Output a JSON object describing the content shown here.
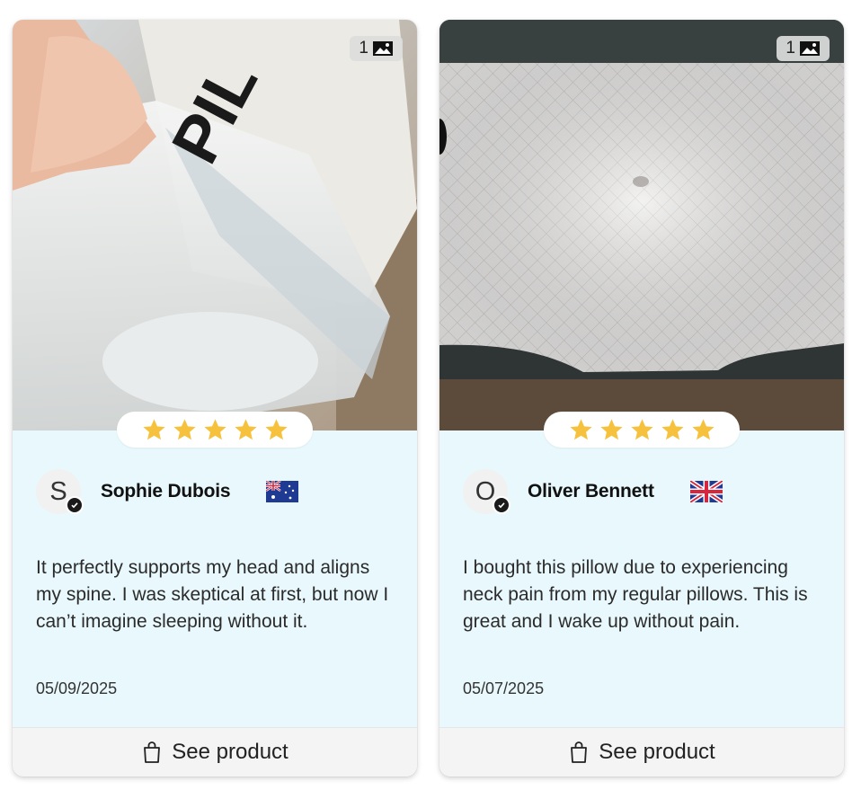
{
  "reviews": [
    {
      "image_count": "1",
      "image_icon": "image-icon",
      "rating": 5,
      "initial": "S",
      "name": "Sophie Dubois",
      "flag": "flag-australia",
      "text": "It perfectly supports my head and aligns my spine. I was skeptical at first, but now I can’t imagine sleeping without it.",
      "date": "05/09/2025",
      "cta": "See product",
      "cta_icon": "shopping-bag-icon"
    },
    {
      "image_count": "1",
      "image_icon": "image-icon",
      "rating": 5,
      "initial": "O",
      "name": "Oliver Bennett",
      "flag": "flag-united-kingdom",
      "text": "I bought this pillow due to experiencing neck pain from my regular pillows. This is great and I wake up without pain.",
      "date": "05/07/2025",
      "cta": "See product",
      "cta_icon": "shopping-bag-icon"
    }
  ],
  "colors": {
    "card_body": "#e8f8fc",
    "star": "#f6c23e",
    "footer": "#f4f4f4"
  }
}
